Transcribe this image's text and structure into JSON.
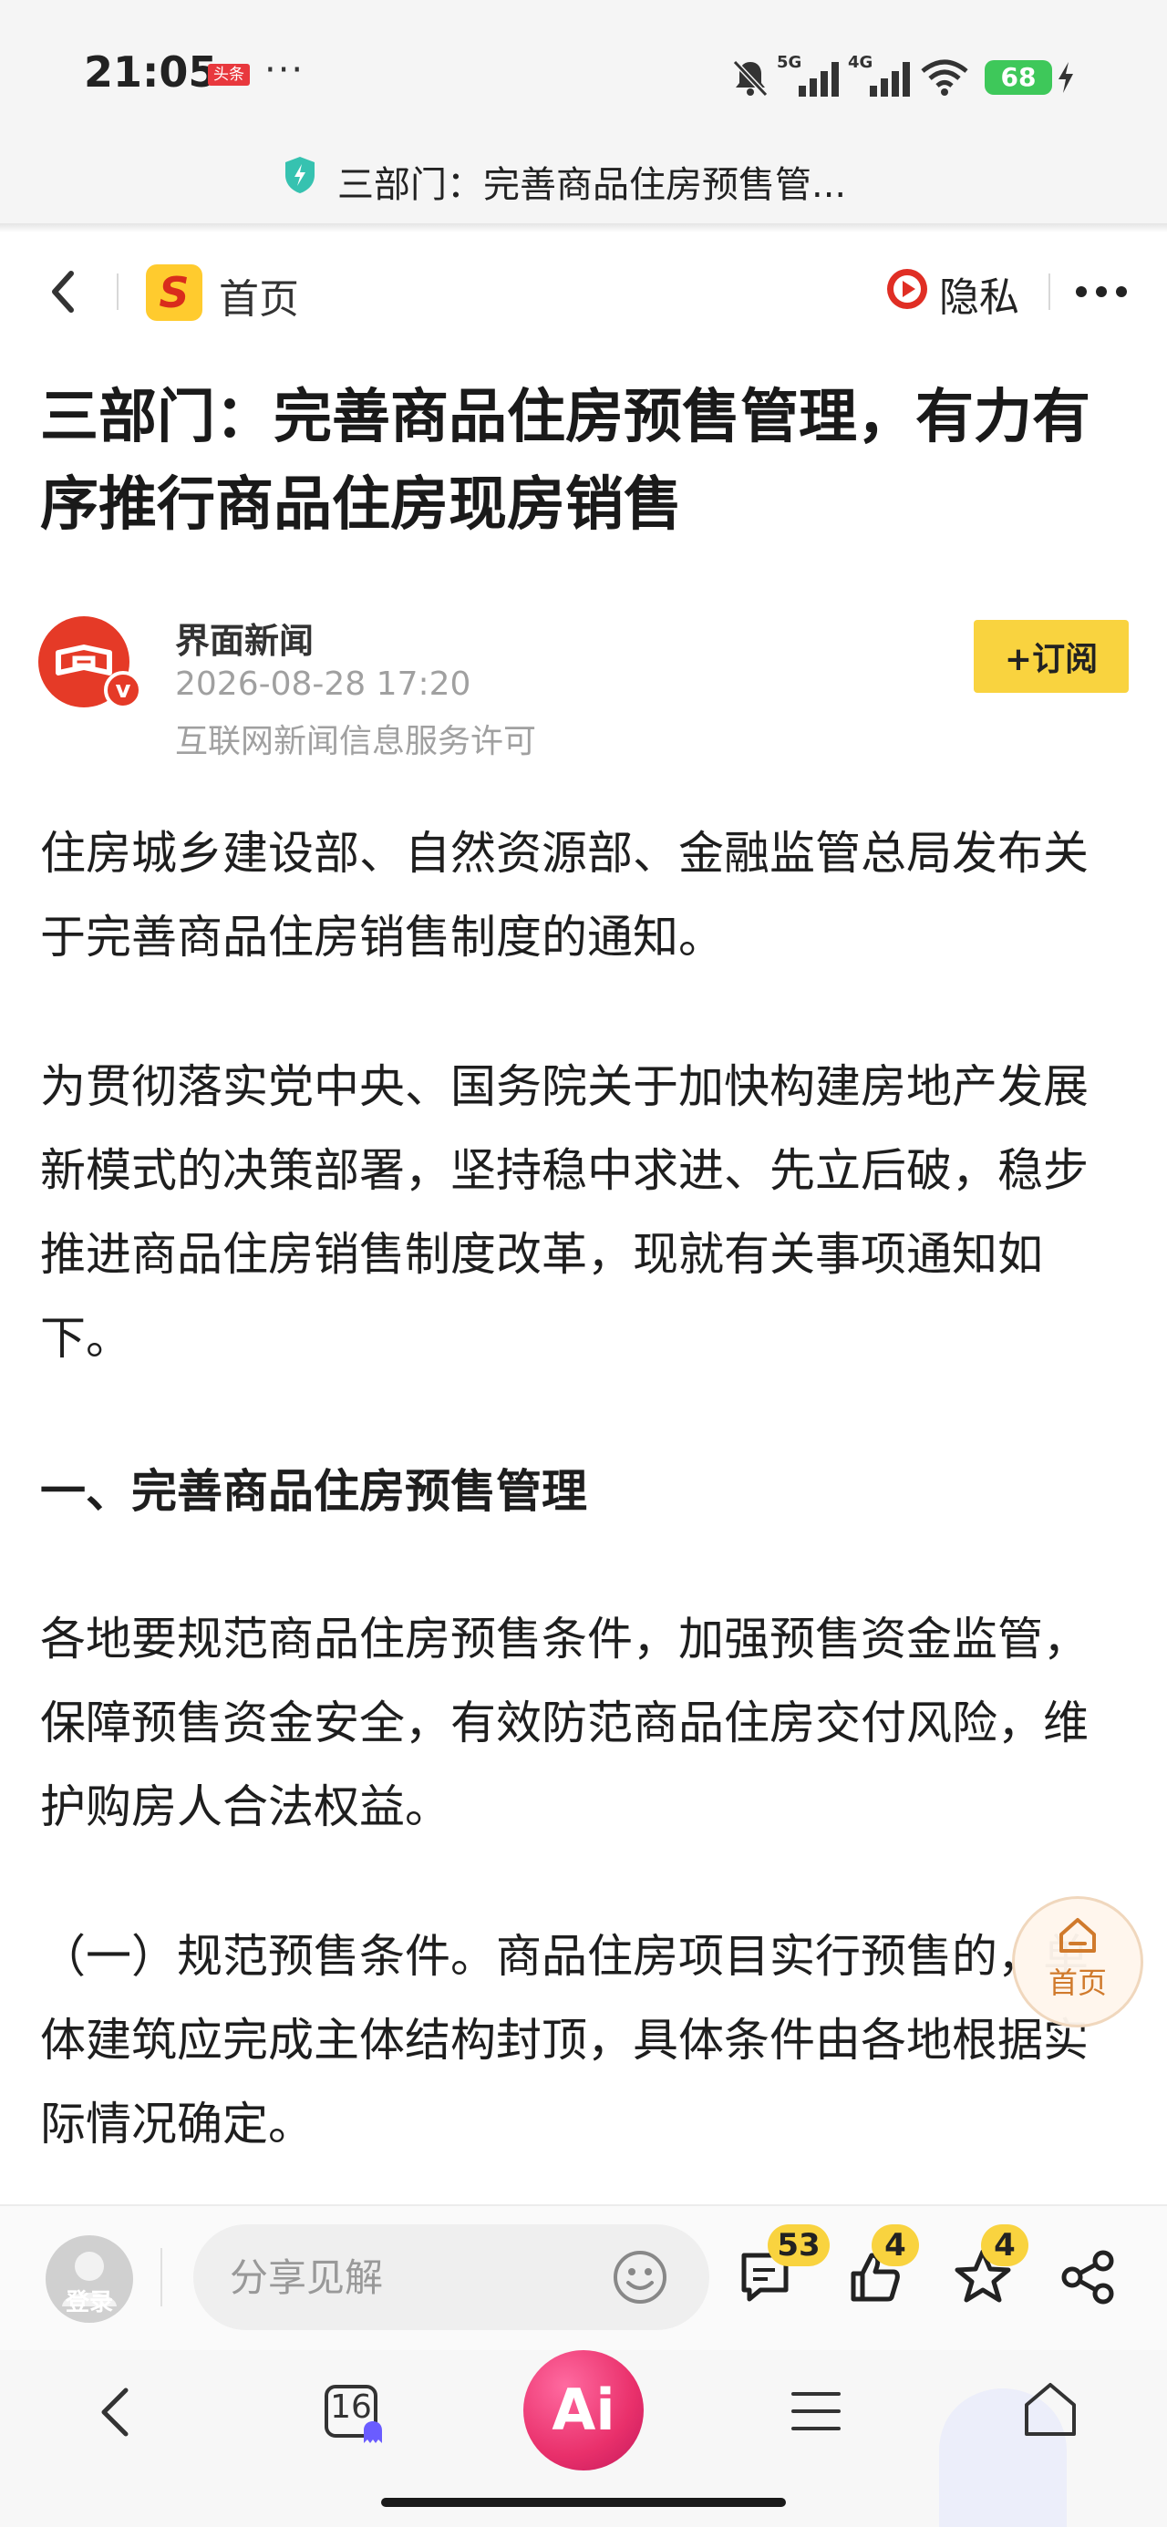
{
  "status_bar": {
    "time": "21:05",
    "app_badge": "头条",
    "more": "···",
    "signal_1": "5G",
    "signal_2": "4G",
    "battery": "68"
  },
  "url_bar": {
    "title": "三部门：完善商品住房预售管..."
  },
  "nav": {
    "home_label": "首页",
    "app_logo_letter": "S",
    "privacy_label": "隐私"
  },
  "article": {
    "title": "三部门：完善商品住房预售管理，有力有序推行商品住房现房销售",
    "source": {
      "name": "界面新闻",
      "time": "2026-08-28 17:20",
      "license": "互联网新闻信息服务许可",
      "verified_mark": "v"
    },
    "subscribe_label": "+订阅",
    "paragraphs": [
      "住房城乡建设部、自然资源部、金融监管总局发布关于完善商品住房销售制度的通知。",
      "为贯彻落实党中央、国务院关于加快构建房地产发展新模式的决策部署，坚持稳中求进、先立后破，稳步推进商品住房销售制度改革，现就有关事项通知如下。",
      "各地要规范商品住房预售条件，加强预售资金监管，保障预售资金安全，有效防范商品住房交付风险，维护购房人合法权益。",
      "（一）规范预售条件。商品住房项目实行预售的，单体建筑应完成主体结构封顶，具体条件由各地根据实际情况确定。"
    ],
    "section_heading": "一、完善商品住房预售管理"
  },
  "floating_home": {
    "label": "首页"
  },
  "comment_bar": {
    "login_label": "登录",
    "input_placeholder": "分享见解",
    "comment_count": "53",
    "like_count": "4",
    "favorite_count": "4"
  },
  "bottom_nav": {
    "tab_count": "16",
    "ai_label": "Ai"
  },
  "colors": {
    "accent_yellow": "#f9d33f",
    "brand_red": "#e53a27",
    "ai_pink": "#e9306b",
    "battery_green": "#3ec85a"
  }
}
